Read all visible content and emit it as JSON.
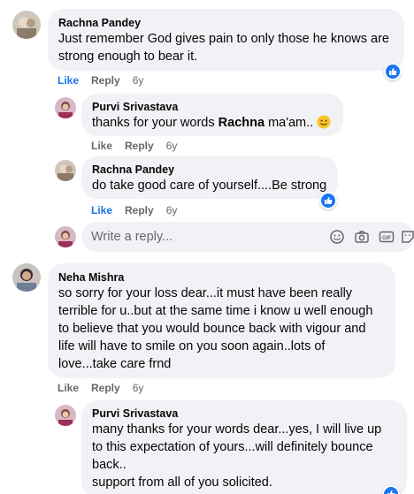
{
  "comments": [
    {
      "author": "Rachna Pandey",
      "text": "Just remember God gives pain to only those he knows are strong enough to bear it.",
      "actions": {
        "like": "Like",
        "reply": "Reply",
        "time": "6y"
      }
    },
    {
      "author": "Purvi Srivastava",
      "text_before": "thanks for your words ",
      "text_bold": "Rachna",
      "text_after": " ma'am..",
      "actions": {
        "like": "Like",
        "reply": "Reply",
        "time": "6y"
      }
    },
    {
      "author": "Rachna Pandey",
      "text": "do take good care of yourself....Be strong",
      "actions": {
        "like": "Like",
        "reply": "Reply",
        "time": "6y"
      }
    },
    {
      "author": "Neha Mishra",
      "text": "so sorry for your loss dear...it must have been really\nterrible for u..but at the same time i know u well enough\nto believe that you would bounce back with vigour and\nlife will have to smile on you soon again..lots of\nlove...take care frnd",
      "actions": {
        "like": "Like",
        "reply": "Reply",
        "time": "6y"
      }
    },
    {
      "author": "Purvi Srivastava",
      "text": "many thanks for your words dear...yes, I will live up\nto this expectation of yours...will definitely bounce\nback..\nsupport from all of you solicited."
    }
  ],
  "reply_box": {
    "placeholder": "Write a reply...",
    "icons": [
      "smiley-icon",
      "camera-icon",
      "gif-icon",
      "sticker-icon"
    ]
  },
  "colors": {
    "bubble": "#f0f2f5",
    "link_blue": "#1b74e4",
    "meta_gray": "#65676b",
    "like_blue": "#1877f2"
  }
}
